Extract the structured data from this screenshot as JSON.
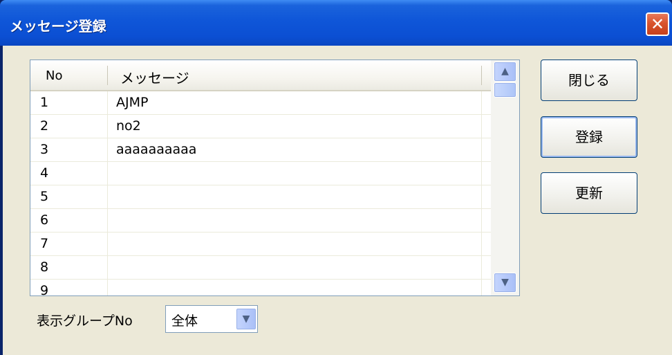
{
  "window": {
    "title": "メッセージ登録",
    "close_glyph": "✕"
  },
  "listview": {
    "columns": [
      "No",
      "メッセージ"
    ],
    "rows": [
      {
        "no": "1",
        "message": "AJMP"
      },
      {
        "no": "2",
        "message": "no2"
      },
      {
        "no": "3",
        "message": "aaaaaaaaaa"
      },
      {
        "no": "4",
        "message": ""
      },
      {
        "no": "5",
        "message": ""
      },
      {
        "no": "6",
        "message": ""
      },
      {
        "no": "7",
        "message": ""
      },
      {
        "no": "8",
        "message": ""
      },
      {
        "no": "9",
        "message": ""
      }
    ],
    "scroll_up_glyph": "▲",
    "scroll_down_glyph": "▼"
  },
  "buttons": {
    "close": "閉じる",
    "register": "登録",
    "update": "更新"
  },
  "filter": {
    "label": "表示グループNo",
    "selected": "全体",
    "dropdown_glyph": "▼"
  },
  "colors": {
    "titlebar": "#0b4fd3",
    "dialog_bg": "#ece9d8",
    "close_button": "#d9542d"
  },
  "icons": [
    "close-icon",
    "scroll-up-icon",
    "scroll-down-icon",
    "dropdown-arrow-icon"
  ]
}
